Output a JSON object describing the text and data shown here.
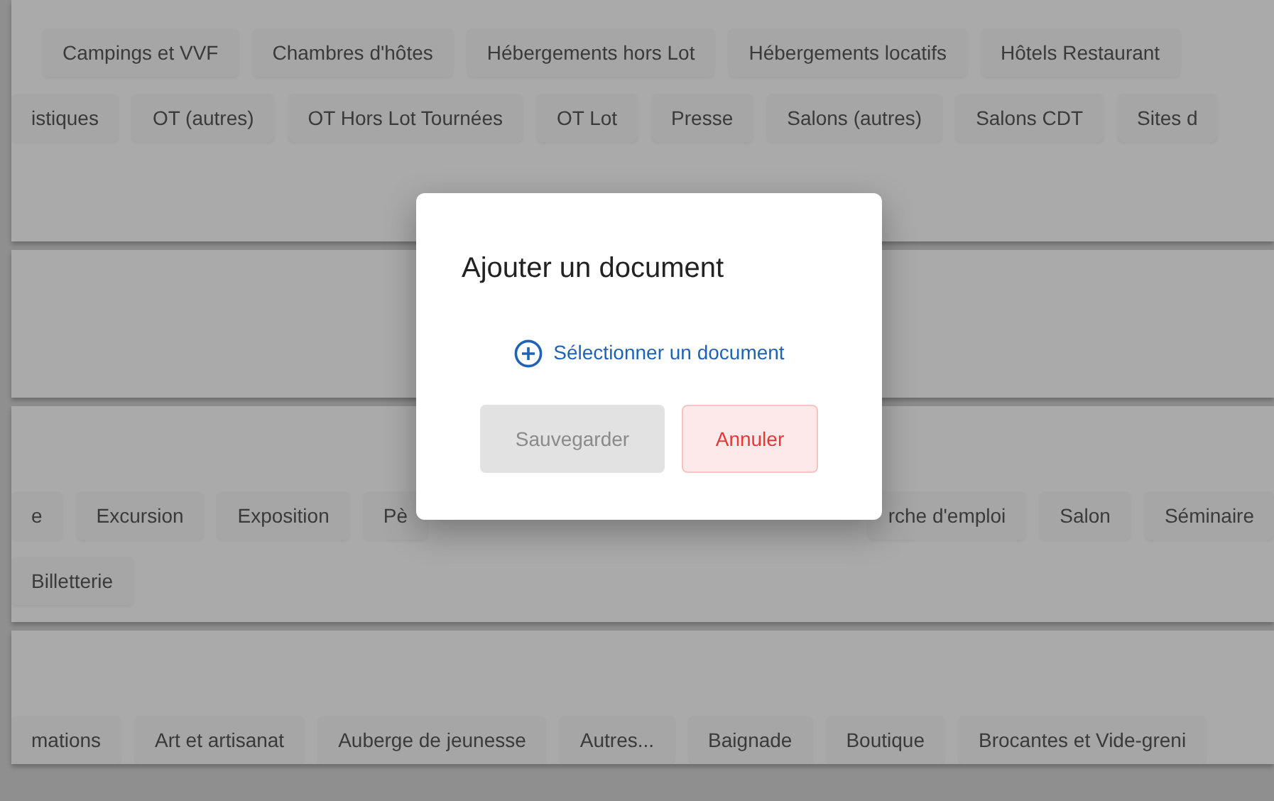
{
  "cards": [
    {
      "kind": "chips",
      "rows": [
        {
          "chips": [
            "Campings et VVF",
            "Chambres d'hôtes",
            "Hébergements hors Lot",
            "Hébergements locatifs",
            "Hôtels Restaurant"
          ]
        },
        {
          "chips": [
            "istiques",
            "OT (autres)",
            "OT Hors Lot Tournées",
            "OT Lot",
            "Presse",
            "Salons (autres)",
            "Salons CDT",
            "Sites d"
          ]
        }
      ]
    },
    {
      "kind": "empty"
    },
    {
      "kind": "chips",
      "rows": [
        {
          "chips": [
            "e",
            "Excursion",
            "Exposition",
            "Pè",
            "rche d'emploi",
            "Salon",
            "Séminaire"
          ]
        },
        {
          "chips": [
            "Billetterie"
          ]
        }
      ]
    },
    {
      "kind": "chips",
      "rows": [
        {
          "chips": [
            "mations",
            "Art et artisanat",
            "Auberge de jeunesse",
            "Autres...",
            "Baignade",
            "Boutique",
            "Brocantes et Vide-greni"
          ]
        }
      ]
    }
  ],
  "dialog": {
    "title": "Ajouter un document",
    "link": "Sélectionner un document",
    "buttons": [
      {
        "label": "Sauvegarder",
        "kind": "save",
        "disabled": true
      },
      {
        "label": "Annuler",
        "kind": "cancel",
        "disabled": false
      }
    ]
  }
}
